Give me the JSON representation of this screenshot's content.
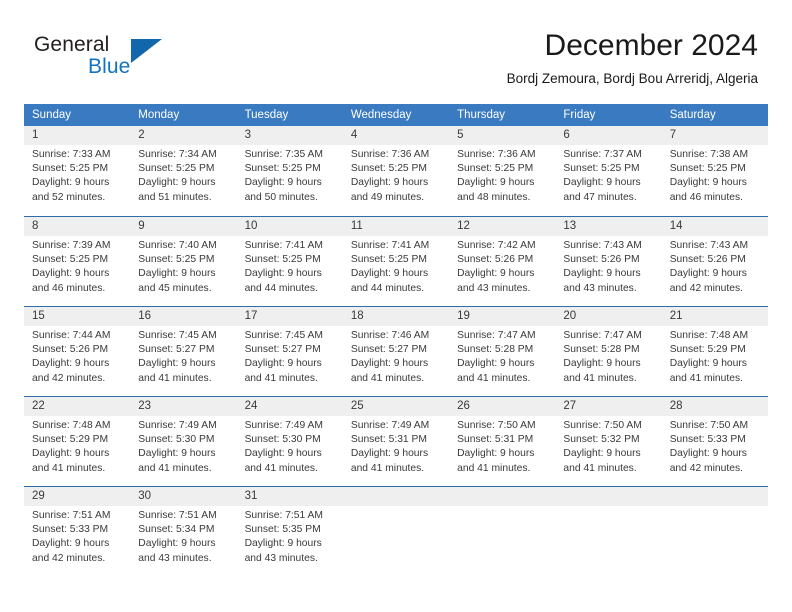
{
  "brand": {
    "name_part1": "General",
    "name_part2": "Blue",
    "triangle_color": "#1266ab",
    "blue_color": "#1273c4"
  },
  "header": {
    "title": "December 2024",
    "subtitle": "Bordj Zemoura, Bordj Bou Arreridj, Algeria"
  },
  "theme": {
    "header_blue": "#3a7ac0",
    "row_divider_blue": "#2f6cad",
    "daynum_band_gray": "#efefef",
    "text_color": "#3a3a3a"
  },
  "weekdays": [
    "Sunday",
    "Monday",
    "Tuesday",
    "Wednesday",
    "Thursday",
    "Friday",
    "Saturday"
  ],
  "weeks": [
    [
      {
        "day": "1",
        "lines": [
          "Sunrise: 7:33 AM",
          "Sunset: 5:25 PM",
          "Daylight: 9 hours",
          "and 52 minutes."
        ]
      },
      {
        "day": "2",
        "lines": [
          "Sunrise: 7:34 AM",
          "Sunset: 5:25 PM",
          "Daylight: 9 hours",
          "and 51 minutes."
        ]
      },
      {
        "day": "3",
        "lines": [
          "Sunrise: 7:35 AM",
          "Sunset: 5:25 PM",
          "Daylight: 9 hours",
          "and 50 minutes."
        ]
      },
      {
        "day": "4",
        "lines": [
          "Sunrise: 7:36 AM",
          "Sunset: 5:25 PM",
          "Daylight: 9 hours",
          "and 49 minutes."
        ]
      },
      {
        "day": "5",
        "lines": [
          "Sunrise: 7:36 AM",
          "Sunset: 5:25 PM",
          "Daylight: 9 hours",
          "and 48 minutes."
        ]
      },
      {
        "day": "6",
        "lines": [
          "Sunrise: 7:37 AM",
          "Sunset: 5:25 PM",
          "Daylight: 9 hours",
          "and 47 minutes."
        ]
      },
      {
        "day": "7",
        "lines": [
          "Sunrise: 7:38 AM",
          "Sunset: 5:25 PM",
          "Daylight: 9 hours",
          "and 46 minutes."
        ]
      }
    ],
    [
      {
        "day": "8",
        "lines": [
          "Sunrise: 7:39 AM",
          "Sunset: 5:25 PM",
          "Daylight: 9 hours",
          "and 46 minutes."
        ]
      },
      {
        "day": "9",
        "lines": [
          "Sunrise: 7:40 AM",
          "Sunset: 5:25 PM",
          "Daylight: 9 hours",
          "and 45 minutes."
        ]
      },
      {
        "day": "10",
        "lines": [
          "Sunrise: 7:41 AM",
          "Sunset: 5:25 PM",
          "Daylight: 9 hours",
          "and 44 minutes."
        ]
      },
      {
        "day": "11",
        "lines": [
          "Sunrise: 7:41 AM",
          "Sunset: 5:25 PM",
          "Daylight: 9 hours",
          "and 44 minutes."
        ]
      },
      {
        "day": "12",
        "lines": [
          "Sunrise: 7:42 AM",
          "Sunset: 5:26 PM",
          "Daylight: 9 hours",
          "and 43 minutes."
        ]
      },
      {
        "day": "13",
        "lines": [
          "Sunrise: 7:43 AM",
          "Sunset: 5:26 PM",
          "Daylight: 9 hours",
          "and 43 minutes."
        ]
      },
      {
        "day": "14",
        "lines": [
          "Sunrise: 7:43 AM",
          "Sunset: 5:26 PM",
          "Daylight: 9 hours",
          "and 42 minutes."
        ]
      }
    ],
    [
      {
        "day": "15",
        "lines": [
          "Sunrise: 7:44 AM",
          "Sunset: 5:26 PM",
          "Daylight: 9 hours",
          "and 42 minutes."
        ]
      },
      {
        "day": "16",
        "lines": [
          "Sunrise: 7:45 AM",
          "Sunset: 5:27 PM",
          "Daylight: 9 hours",
          "and 41 minutes."
        ]
      },
      {
        "day": "17",
        "lines": [
          "Sunrise: 7:45 AM",
          "Sunset: 5:27 PM",
          "Daylight: 9 hours",
          "and 41 minutes."
        ]
      },
      {
        "day": "18",
        "lines": [
          "Sunrise: 7:46 AM",
          "Sunset: 5:27 PM",
          "Daylight: 9 hours",
          "and 41 minutes."
        ]
      },
      {
        "day": "19",
        "lines": [
          "Sunrise: 7:47 AM",
          "Sunset: 5:28 PM",
          "Daylight: 9 hours",
          "and 41 minutes."
        ]
      },
      {
        "day": "20",
        "lines": [
          "Sunrise: 7:47 AM",
          "Sunset: 5:28 PM",
          "Daylight: 9 hours",
          "and 41 minutes."
        ]
      },
      {
        "day": "21",
        "lines": [
          "Sunrise: 7:48 AM",
          "Sunset: 5:29 PM",
          "Daylight: 9 hours",
          "and 41 minutes."
        ]
      }
    ],
    [
      {
        "day": "22",
        "lines": [
          "Sunrise: 7:48 AM",
          "Sunset: 5:29 PM",
          "Daylight: 9 hours",
          "and 41 minutes."
        ]
      },
      {
        "day": "23",
        "lines": [
          "Sunrise: 7:49 AM",
          "Sunset: 5:30 PM",
          "Daylight: 9 hours",
          "and 41 minutes."
        ]
      },
      {
        "day": "24",
        "lines": [
          "Sunrise: 7:49 AM",
          "Sunset: 5:30 PM",
          "Daylight: 9 hours",
          "and 41 minutes."
        ]
      },
      {
        "day": "25",
        "lines": [
          "Sunrise: 7:49 AM",
          "Sunset: 5:31 PM",
          "Daylight: 9 hours",
          "and 41 minutes."
        ]
      },
      {
        "day": "26",
        "lines": [
          "Sunrise: 7:50 AM",
          "Sunset: 5:31 PM",
          "Daylight: 9 hours",
          "and 41 minutes."
        ]
      },
      {
        "day": "27",
        "lines": [
          "Sunrise: 7:50 AM",
          "Sunset: 5:32 PM",
          "Daylight: 9 hours",
          "and 41 minutes."
        ]
      },
      {
        "day": "28",
        "lines": [
          "Sunrise: 7:50 AM",
          "Sunset: 5:33 PM",
          "Daylight: 9 hours",
          "and 42 minutes."
        ]
      }
    ],
    [
      {
        "day": "29",
        "lines": [
          "Sunrise: 7:51 AM",
          "Sunset: 5:33 PM",
          "Daylight: 9 hours",
          "and 42 minutes."
        ]
      },
      {
        "day": "30",
        "lines": [
          "Sunrise: 7:51 AM",
          "Sunset: 5:34 PM",
          "Daylight: 9 hours",
          "and 43 minutes."
        ]
      },
      {
        "day": "31",
        "lines": [
          "Sunrise: 7:51 AM",
          "Sunset: 5:35 PM",
          "Daylight: 9 hours",
          "and 43 minutes."
        ]
      },
      {
        "day": "",
        "lines": []
      },
      {
        "day": "",
        "lines": []
      },
      {
        "day": "",
        "lines": []
      },
      {
        "day": "",
        "lines": []
      }
    ]
  ]
}
